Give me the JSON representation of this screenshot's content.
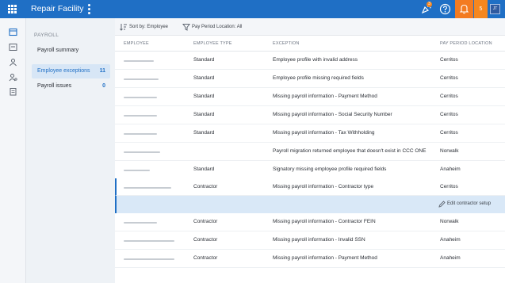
{
  "app": {
    "title": "Repair Facility"
  },
  "topbar": {
    "notification_count": "5",
    "user_initials": "JT",
    "badge_count": "3"
  },
  "subnav": {
    "heading": "PAYROLL",
    "items": [
      {
        "label": "Payroll summary",
        "count": ""
      },
      {
        "label": "Employee exceptions",
        "count": "11"
      },
      {
        "label": "Payroll issues",
        "count": "0"
      }
    ]
  },
  "toolbar": {
    "sort_label": "Sort by: Employee",
    "filter_label": "Pay Period Location: All"
  },
  "table": {
    "columns": [
      "EMPLOYEE",
      "EMPLOYEE TYPE",
      "EXCEPTION",
      "PAY PERIOD LOCATION"
    ],
    "rows": [
      {
        "type": "Standard",
        "exception": "Employee profile with invalid address",
        "location": "Cerritos"
      },
      {
        "type": "Standard",
        "exception": "Employee profile missing required fields",
        "location": "Cerritos"
      },
      {
        "type": "Standard",
        "exception": "Missing payroll information - Payment Method",
        "location": "Cerritos"
      },
      {
        "type": "Standard",
        "exception": "Missing payroll information - Social Security Number",
        "location": "Cerritos"
      },
      {
        "type": "Standard",
        "exception": "Missing payroll information - Tax Withholding",
        "location": "Cerritos"
      },
      {
        "type": "",
        "exception": "Payroll migration returned employee that doesn't exist in CCC ONE",
        "location": "Norwalk"
      },
      {
        "type": "Standard",
        "exception": "Signatory missing employee profile required fields",
        "location": "Anaheim"
      },
      {
        "type": "Contractor",
        "exception": "Missing payroll information - Contractor type",
        "location": "Cerritos"
      },
      {
        "type": "Contractor",
        "exception": "Missing payroll information - Contractor FEIN",
        "location": "Norwalk"
      },
      {
        "type": "Contractor",
        "exception": "Missing payroll information - Invalid SSN",
        "location": "Anaheim"
      },
      {
        "type": "Contractor",
        "exception": "Missing payroll information - Payment Method",
        "location": "Anaheim"
      }
    ],
    "action_label": "Edit contractor setup"
  }
}
